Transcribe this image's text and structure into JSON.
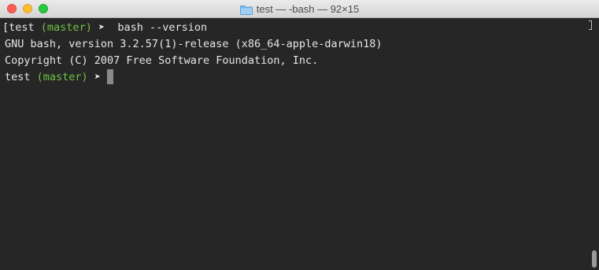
{
  "window": {
    "title": "test — -bash — 92×15",
    "colors": {
      "background": "#262626",
      "text": "#e6e6e6",
      "branch": "#6fc242"
    }
  },
  "terminal": {
    "prompt": {
      "dir": "test",
      "branch": "(master)",
      "symbol": "➤"
    },
    "first_prefix": "[",
    "command": "bash --version",
    "output": [
      "GNU bash, version 3.2.57(1)-release (x86_64-apple-darwin18)",
      "Copyright (C) 2007 Free Software Foundation, Inc."
    ]
  }
}
